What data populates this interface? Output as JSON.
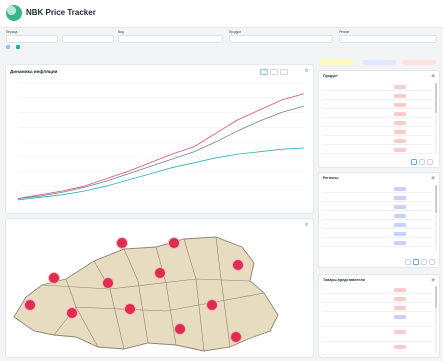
{
  "app": {
    "title": "NBK Price Tracker"
  },
  "filters": {
    "items": [
      {
        "label": "Период",
        "value": ""
      },
      {
        "label": "",
        "value": ""
      },
      {
        "label": "Вид",
        "value": ""
      },
      {
        "label": "Продукт",
        "value": ""
      },
      {
        "label": "Регион",
        "value": ""
      }
    ],
    "legend_chips": [
      {
        "label": "",
        "color": "#93c5fd"
      },
      {
        "label": "",
        "color": "#14b8a6"
      }
    ]
  },
  "chart_panel": {
    "title": "Динамика инфляции",
    "gear_icon": "gear-icon"
  },
  "map_panel": {
    "gear_icon": "gear-icon"
  },
  "right_chips": [
    {
      "label": "",
      "bg": "#fef9c3",
      "fg": "#854d0e"
    },
    {
      "label": "",
      "bg": "#e0e7ff",
      "fg": "#3730a3"
    },
    {
      "label": "",
      "bg": "#fee2e2",
      "fg": "#991b1b"
    }
  ],
  "side_panels": [
    {
      "title": "Продукт",
      "rows": [
        {
          "name": "",
          "tag_color": "#fecaca"
        },
        {
          "name": "",
          "tag_color": "#fecaca"
        },
        {
          "name": "",
          "tag_color": "#fecaca"
        },
        {
          "name": "",
          "tag_color": "#fecaca"
        },
        {
          "name": "",
          "tag_color": "#fecaca"
        },
        {
          "name": "",
          "tag_color": "#fecaca"
        },
        {
          "name": "",
          "tag_color": "#fecaca"
        },
        {
          "name": "",
          "tag_color": "#fecaca"
        }
      ]
    },
    {
      "title": "Регионы",
      "rows": [
        {
          "name": "",
          "tag_color": "#c7d2fe"
        },
        {
          "name": "",
          "tag_color": "#c7d2fe"
        },
        {
          "name": "",
          "tag_color": "#c7d2fe"
        },
        {
          "name": "",
          "tag_color": "#c7d2fe"
        },
        {
          "name": "",
          "tag_color": "#c7d2fe"
        },
        {
          "name": "",
          "tag_color": "#c7d2fe"
        },
        {
          "name": "",
          "tag_color": "#c7d2fe"
        }
      ]
    },
    {
      "title": "Товары-представители",
      "rows": [
        {
          "name": "",
          "tag_color": "#fecaca"
        },
        {
          "name": "",
          "tag_color": "#fecaca"
        },
        {
          "name": "",
          "tag_color": "#fecaca"
        },
        {
          "name": "",
          "tag_color": "#c7d2fe"
        },
        {
          "name": "",
          "tag_color": "#fecaca"
        },
        {
          "name": "",
          "tag_color": "#fecaca"
        }
      ]
    }
  ],
  "chart_data": {
    "type": "line",
    "series": [
      {
        "color": "#e0506e",
        "values": [
          2,
          5,
          8,
          12,
          18,
          24,
          31,
          38,
          44,
          55,
          66,
          74,
          82,
          87
        ]
      },
      {
        "color": "#6b7fa8",
        "values": [
          2,
          4,
          7,
          11,
          16,
          22,
          28,
          34,
          40,
          48,
          57,
          65,
          72,
          77
        ]
      },
      {
        "color": "#2db1b6",
        "values": [
          1,
          3,
          5,
          8,
          12,
          17,
          22,
          27,
          31,
          35,
          38,
          40,
          42,
          43
        ]
      }
    ]
  }
}
